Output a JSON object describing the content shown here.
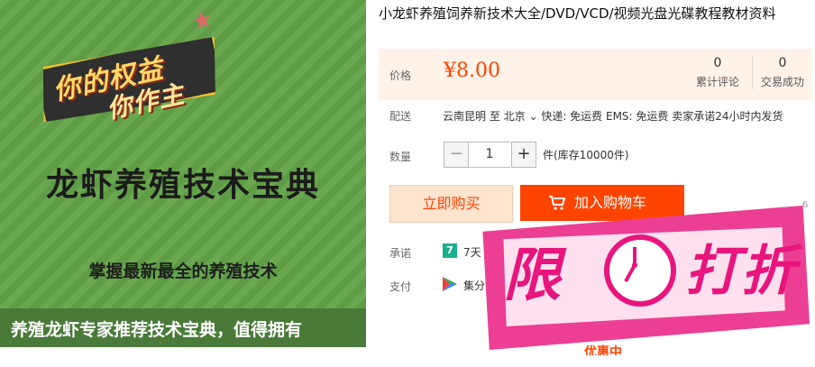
{
  "product_image": {
    "slogan_line1": "你的权益",
    "slogan_line2": "你作主",
    "title": "龙虾养殖技术宝典",
    "subtitle": "掌握最新最全的养殖技术",
    "bottom_text": "养殖龙虾专家推荐技术宝典，值得拥有",
    "watermark": "",
    "background_color": "#6aa84f"
  },
  "item": {
    "title": "小龙虾养殖饲养新技术大全/DVD/VCD/视频光盘光碟教程教材资料"
  },
  "price": {
    "label": "价格",
    "value": "¥8.00",
    "stats": [
      {
        "num": "0",
        "label": "累计评论"
      },
      {
        "num": "0",
        "label": "交易成功"
      }
    ],
    "accent_color": "#ff4400",
    "panel_color": "#fff2e8"
  },
  "shipping": {
    "label": "配送",
    "text": "云南昆明  至  北京 ⌄ 快递: 免运费 EMS: 免运费  卖家承诺24小时内发货"
  },
  "quantity": {
    "label": "数量",
    "minus": "−",
    "value": "1",
    "plus": "+",
    "stock": "件(库存10000件)"
  },
  "actions": {
    "buy_now": "立即购买",
    "add_to_cart": "加入购物车"
  },
  "promise": {
    "label": "承诺",
    "icon_text": "7",
    "text": "7天"
  },
  "payment": {
    "label": "支付",
    "text": "集分"
  },
  "promo": {
    "char1": "限",
    "char2": "打折",
    "tail_text": "优惠中"
  },
  "edge": {
    "text": "6"
  }
}
